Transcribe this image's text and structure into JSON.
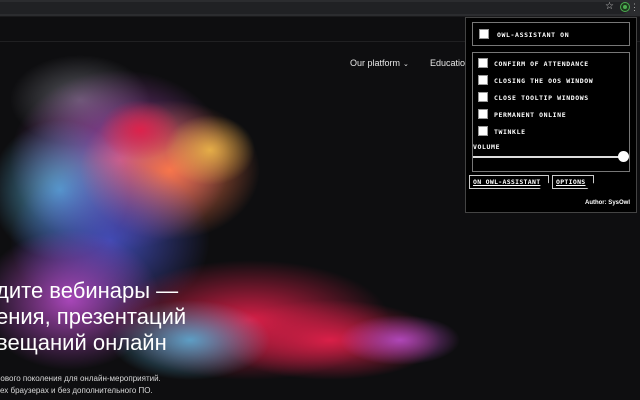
{
  "nav": {
    "items": [
      {
        "label": "Our platform",
        "has_dropdown": true
      },
      {
        "label": "Educatio"
      }
    ]
  },
  "hero": {
    "title_lines": [
      "дите вебинары —",
      "ения, презентаций",
      "вещаний онлайн"
    ],
    "sub_lines": [
      "нового поколения для онлайн-мероприятий.",
      "сех браузерах и без дополнительного ПО."
    ]
  },
  "extension": {
    "toggle_label": "OWL-ASSISTANT ON",
    "options": [
      {
        "label": "CONFIRM OF ATTENDANCE"
      },
      {
        "label": "CLOSING THE OOS WINDOW"
      },
      {
        "label": "CLOSE TOOLTIP WINDOWS"
      },
      {
        "label": "PERMANENT ONLINE"
      },
      {
        "label": "TWINKLE"
      }
    ],
    "volume_label": "VOLUME",
    "volume_level": 1.0,
    "tab_on_label": "ON OWL-ASSISTANT",
    "tab_options_label": "OPTIONS",
    "author": "Author: SysOwl"
  },
  "icons": {
    "bookmark": "star-icon",
    "extension": "owl-extension-icon"
  },
  "colors": {
    "background": "#0e0e10",
    "popup_bg": "#000000",
    "extension_accent": "#4caf50"
  }
}
